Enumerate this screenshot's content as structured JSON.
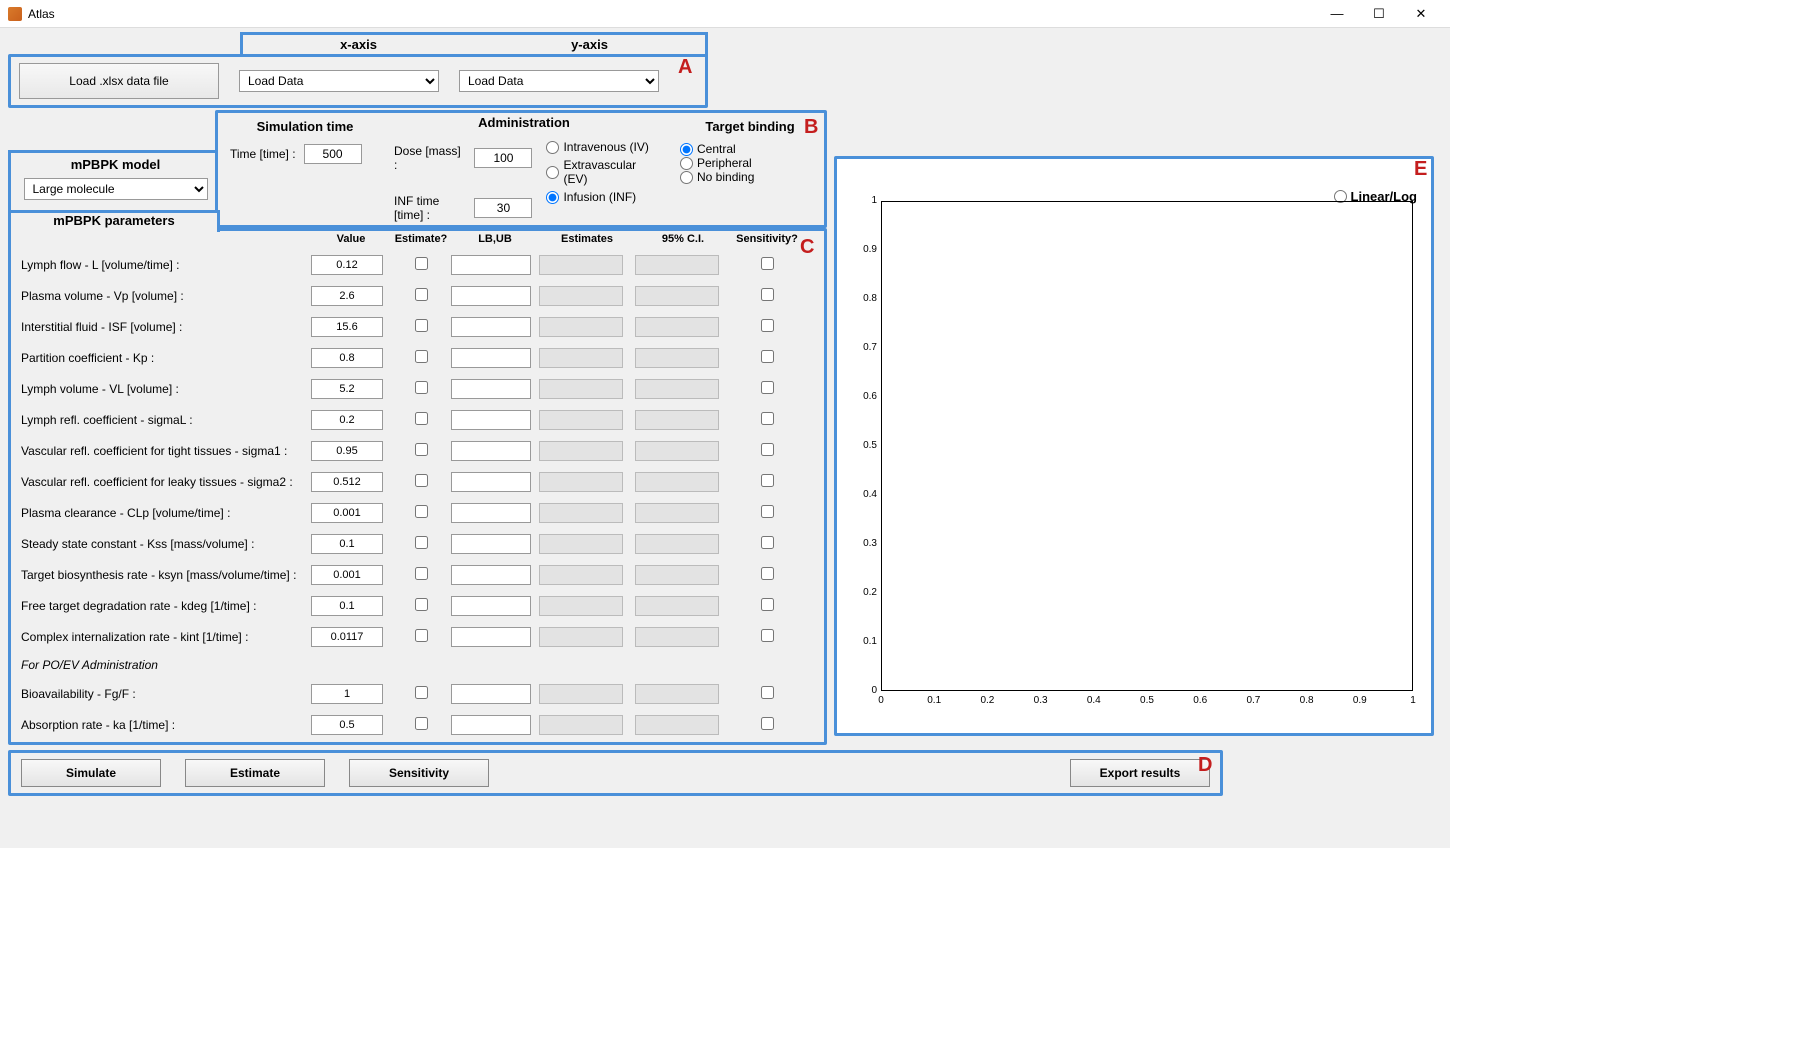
{
  "window": {
    "title": "Atlas"
  },
  "panelA": {
    "load_btn": "Load .xlsx data file",
    "x_axis_header": "x-axis",
    "y_axis_header": "y-axis",
    "x_select": "Load Data",
    "y_select": "Load Data"
  },
  "panelB": {
    "model_header": "mPBPK model",
    "model_select": "Large molecule",
    "sim_header": "Simulation time",
    "time_label": "Time [time] :",
    "time_value": "500",
    "admin_header": "Administration",
    "dose_label": "Dose [mass] :",
    "dose_value": "100",
    "inf_label": "INF time [time] :",
    "inf_value": "30",
    "admin_options": [
      "Intravenous (IV)",
      "Extravascular (EV)",
      "Infusion (INF)"
    ],
    "admin_selected": 2,
    "target_header": "Target binding",
    "target_options": [
      "Central",
      "Peripheral",
      "No binding"
    ],
    "target_selected": 0
  },
  "panelC": {
    "header": "mPBPK parameters",
    "cols": {
      "value": "Value",
      "est": "Estimate?",
      "lbub": "LB,UB",
      "ests": "Estimates",
      "ci": "95% C.I.",
      "sens": "Sensitivity?"
    },
    "rows": [
      {
        "label": "Lymph flow - L [volume/time] :",
        "value": "0.12"
      },
      {
        "label": "Plasma volume - Vp [volume] :",
        "value": "2.6"
      },
      {
        "label": "Interstitial fluid - ISF [volume] :",
        "value": "15.6"
      },
      {
        "label": "Partition coefficient - Kp :",
        "value": "0.8"
      },
      {
        "label": "Lymph volume - VL [volume] :",
        "value": "5.2"
      },
      {
        "label": "Lymph refl. coefficient - sigmaL :",
        "value": "0.2"
      },
      {
        "label": "Vascular refl. coefficient for tight tissues - sigma1 :",
        "value": "0.95"
      },
      {
        "label": "Vascular refl. coefficient for leaky tissues - sigma2 :",
        "value": "0.512"
      },
      {
        "label": "Plasma clearance - CLp [volume/time] :",
        "value": "0.001"
      },
      {
        "label": "Steady state constant - Kss [mass/volume] :",
        "value": "0.1"
      },
      {
        "label": "Target biosynthesis rate - ksyn [mass/volume/time] :",
        "value": "0.001"
      },
      {
        "label": "Free target degradation rate - kdeg [1/time] :",
        "value": "0.1"
      },
      {
        "label": "Complex internalization rate - kint [1/time] :",
        "value": "0.0117"
      }
    ],
    "sub_header": "For PO/EV Administration",
    "sub_rows": [
      {
        "label": "Bioavailability - Fg/F :",
        "value": "1"
      },
      {
        "label": "Absorption rate - ka [1/time] :",
        "value": "0.5"
      }
    ]
  },
  "panelD": {
    "simulate": "Simulate",
    "estimate": "Estimate",
    "sensitivity": "Sensitivity",
    "export": "Export results"
  },
  "panelE": {
    "toggle": "Linear/Log"
  },
  "chart_data": {
    "type": "scatter",
    "title": "",
    "xlabel": "",
    "ylabel": "",
    "xlim": [
      0,
      1
    ],
    "ylim": [
      0,
      1
    ],
    "xticks": [
      0,
      0.1,
      0.2,
      0.3,
      0.4,
      0.5,
      0.6,
      0.7,
      0.8,
      0.9,
      1
    ],
    "yticks": [
      0,
      0.1,
      0.2,
      0.3,
      0.4,
      0.5,
      0.6,
      0.7,
      0.8,
      0.9,
      1
    ],
    "series": []
  },
  "region_labels": {
    "A": "A",
    "B": "B",
    "C": "C",
    "D": "D",
    "E": "E"
  }
}
